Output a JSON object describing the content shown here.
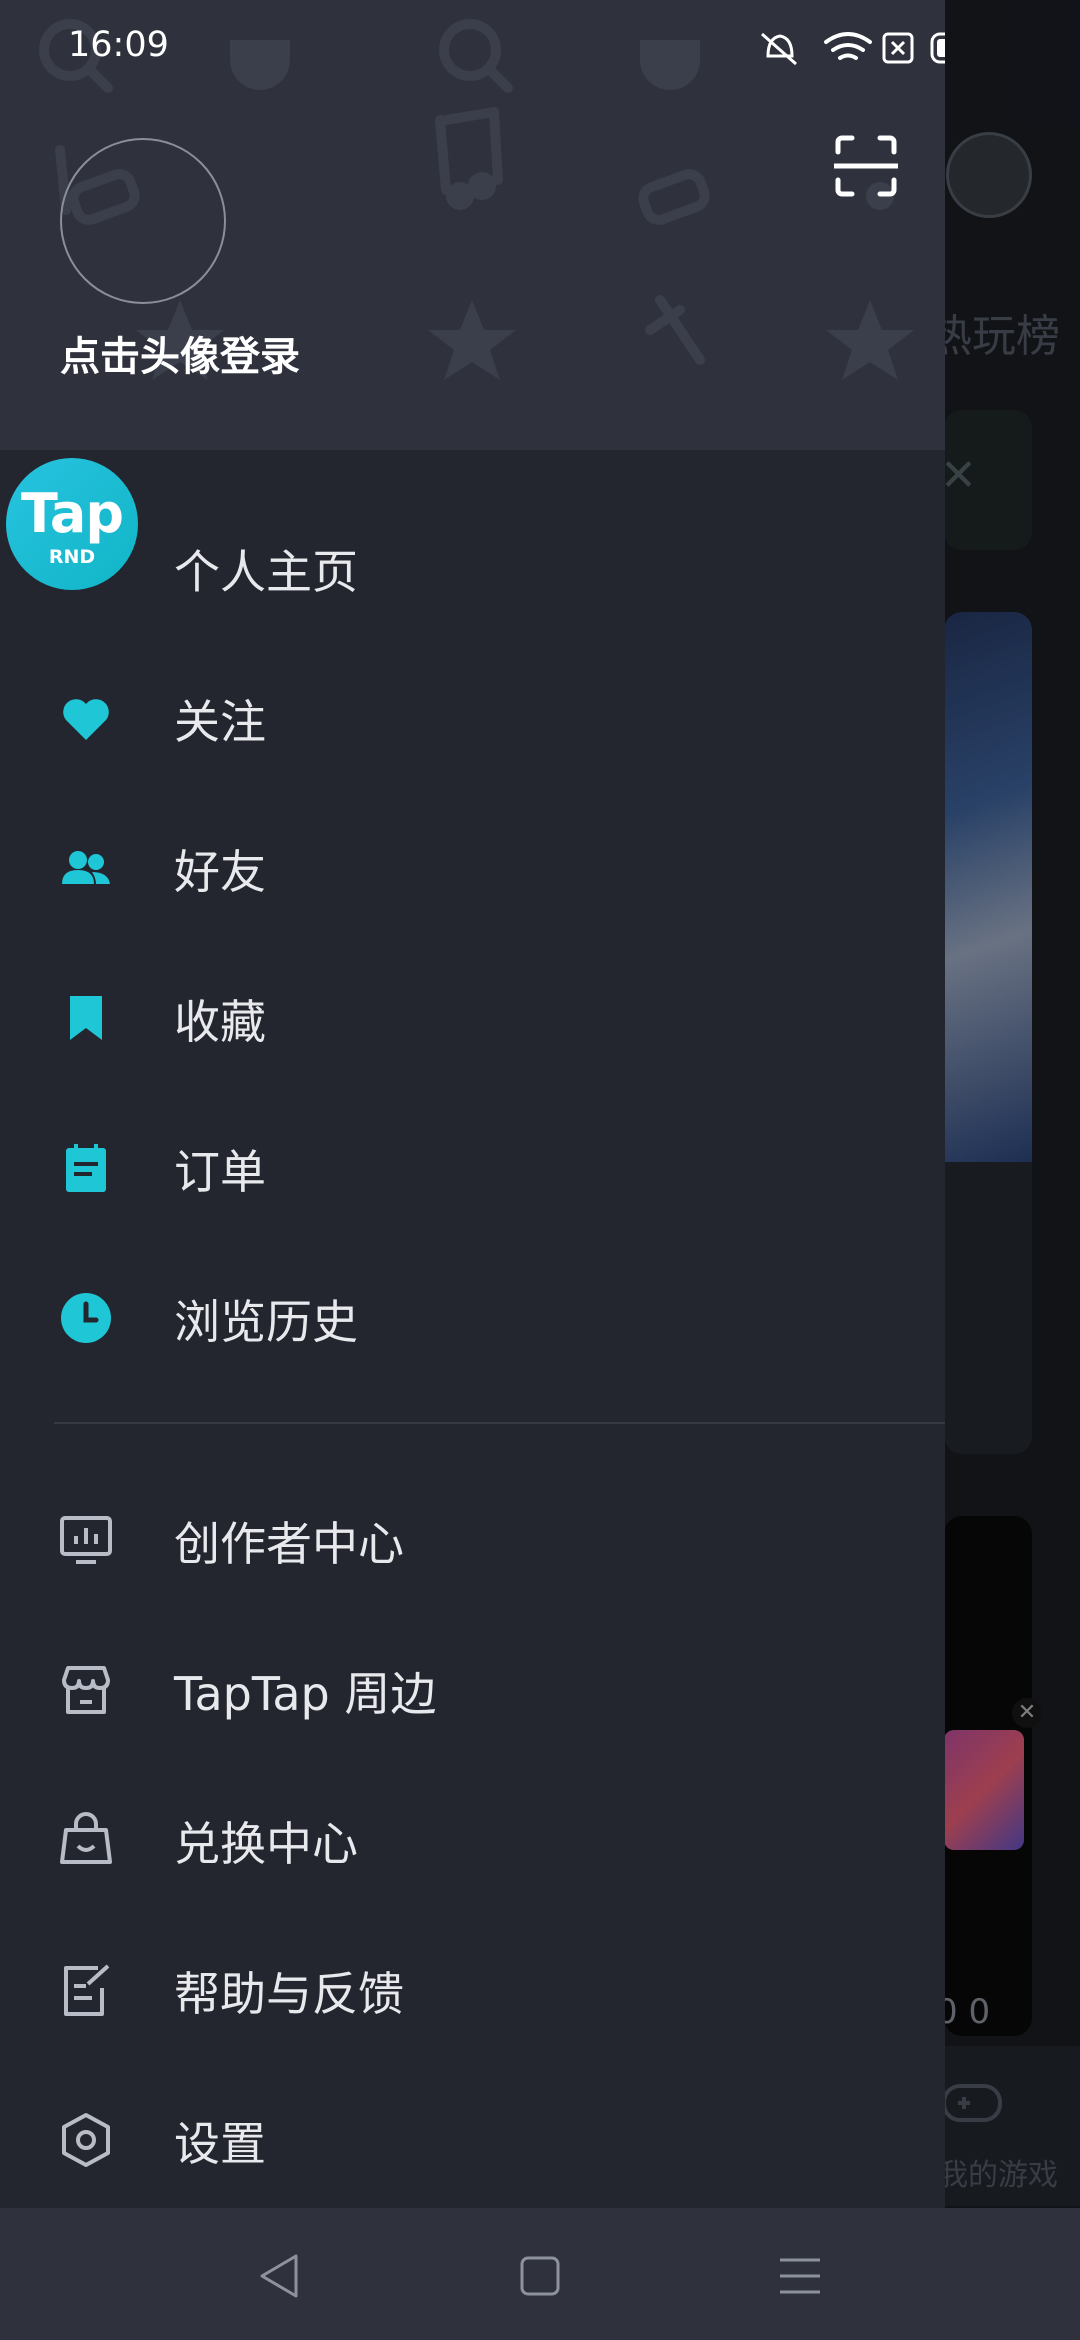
{
  "status_bar": {
    "time": "16:09"
  },
  "drawer": {
    "login_text": "点击头像登录",
    "logo": {
      "main": "Tap",
      "sub": "RND"
    },
    "primary_menu": [
      {
        "label": "个人主页",
        "icon": "home-icon"
      },
      {
        "label": "关注",
        "icon": "heart-icon"
      },
      {
        "label": "好友",
        "icon": "friends-icon"
      },
      {
        "label": "收藏",
        "icon": "bookmark-icon"
      },
      {
        "label": "订单",
        "icon": "order-icon"
      },
      {
        "label": "浏览历史",
        "icon": "clock-icon"
      }
    ],
    "secondary_menu": [
      {
        "label": "创作者中心",
        "icon": "creator-icon"
      },
      {
        "label": "TapTap 周边",
        "icon": "store-icon"
      },
      {
        "label": "兑换中心",
        "icon": "bag-icon"
      },
      {
        "label": "帮助与反馈",
        "icon": "feedback-icon"
      },
      {
        "label": "设置",
        "icon": "settings-icon"
      }
    ]
  },
  "background_page": {
    "ranking_text": "热玩榜",
    "count_text": "0 0",
    "nav_label": "我的游戏"
  },
  "colors": {
    "accent": "#1fc6d6",
    "drawer_bg": "#24262f",
    "header_bg": "#2f323d"
  }
}
